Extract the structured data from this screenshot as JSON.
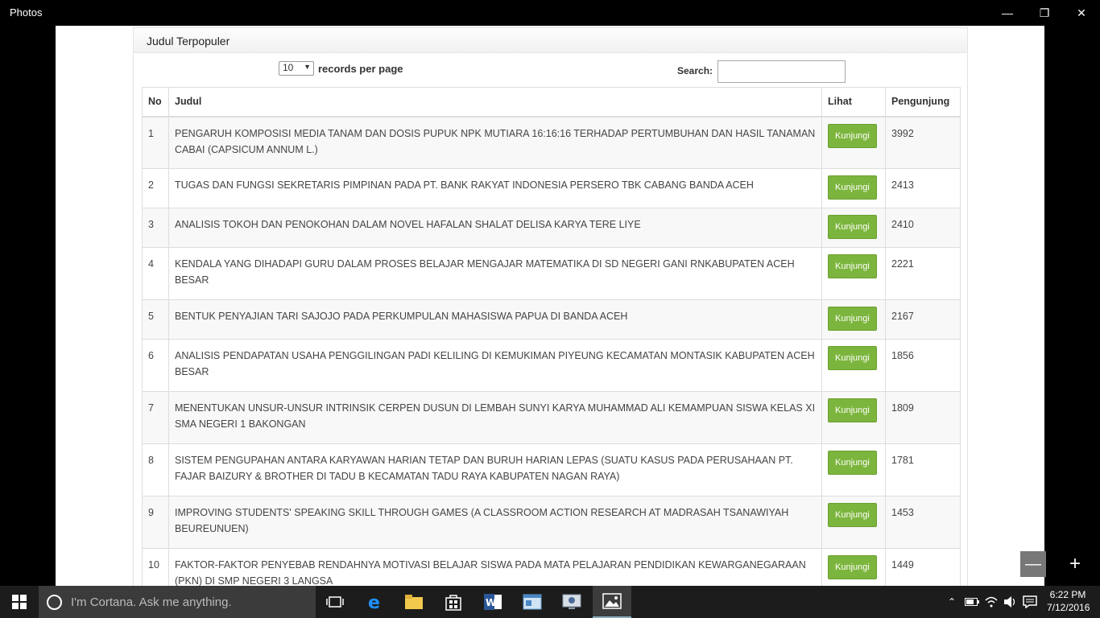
{
  "window": {
    "title": "Photos"
  },
  "panel": {
    "heading": "Judul Terpopuler"
  },
  "controls": {
    "per_page_value": "10",
    "per_page_label": "records per page",
    "search_label": "Search:",
    "search_value": ""
  },
  "table": {
    "headers": [
      "No",
      "Judul",
      "Lihat",
      "Pengunjung"
    ],
    "button_label": "Kunjungi",
    "rows": [
      {
        "no": "1",
        "judul": "PENGARUH KOMPOSISI MEDIA TANAM DAN DOSIS PUPUK NPK MUTIARA 16:16:16 TERHADAP PERTUMBUHAN DAN HASIL TANAMAN CABAI (CAPSICUM ANNUM L.)",
        "pengunjung": "3992"
      },
      {
        "no": "2",
        "judul": "TUGAS DAN FUNGSI SEKRETARIS PIMPINAN PADA PT. BANK RAKYAT INDONESIA PERSERO TBK CABANG BANDA ACEH",
        "pengunjung": "2413"
      },
      {
        "no": "3",
        "judul": "ANALISIS TOKOH DAN PENOKOHAN DALAM NOVEL HAFALAN SHALAT DELISA KARYA TERE LIYE",
        "pengunjung": "2410"
      },
      {
        "no": "4",
        "judul": "KENDALA YANG DIHADAPI GURU DALAM PROSES BELAJAR MENGAJAR MATEMATIKA DI SD NEGERI GANI RNKABUPATEN ACEH BESAR",
        "pengunjung": "2221"
      },
      {
        "no": "5",
        "judul": "BENTUK PENYAJIAN TARI SAJOJO PADA PERKUMPULAN MAHASISWA PAPUA DI BANDA ACEH",
        "pengunjung": "2167"
      },
      {
        "no": "6",
        "judul": "ANALISIS PENDAPATAN USAHA PENGGILINGAN PADI KELILING DI KEMUKIMAN PIYEUNG KECAMATAN MONTASIK KABUPATEN ACEH BESAR",
        "pengunjung": "1856"
      },
      {
        "no": "7",
        "judul": "MENENTUKAN UNSUR-UNSUR INTRINSIK CERPEN DUSUN DI LEMBAH SUNYI KARYA MUHAMMAD ALI KEMAMPUAN SISWA KELAS XI SMA NEGERI 1 BAKONGAN",
        "pengunjung": "1809"
      },
      {
        "no": "8",
        "judul": "SISTEM PENGUPAHAN ANTARA KARYAWAN HARIAN TETAP DAN BURUH HARIAN LEPAS (SUATU KASUS PADA PERUSAHAAN PT. FAJAR BAIZURY & BROTHER DI TADU B KECAMATAN TADU RAYA KABUPATEN NAGAN RAYA)",
        "pengunjung": "1781"
      },
      {
        "no": "9",
        "judul": "IMPROVING STUDENTS' SPEAKING SKILL THROUGH GAMES (A CLASSROOM ACTION RESEARCH AT MADRASAH TSANAWIYAH BEUREUNUEN)",
        "pengunjung": "1453"
      },
      {
        "no": "10",
        "judul": "FAKTOR-FAKTOR PENYEBAB RENDAHNYA MOTIVASI BELAJAR SISWA PADA MATA PELAJARAN PENDIDIKAN KEWARGANEGARAAN (PKN) DI SMP NEGERI 3 LANGSA",
        "pengunjung": "1449"
      }
    ]
  },
  "taskbar": {
    "cortana_placeholder": "I'm Cortana. Ask me anything.",
    "time": "6:22 PM",
    "date": "7/12/2016"
  }
}
